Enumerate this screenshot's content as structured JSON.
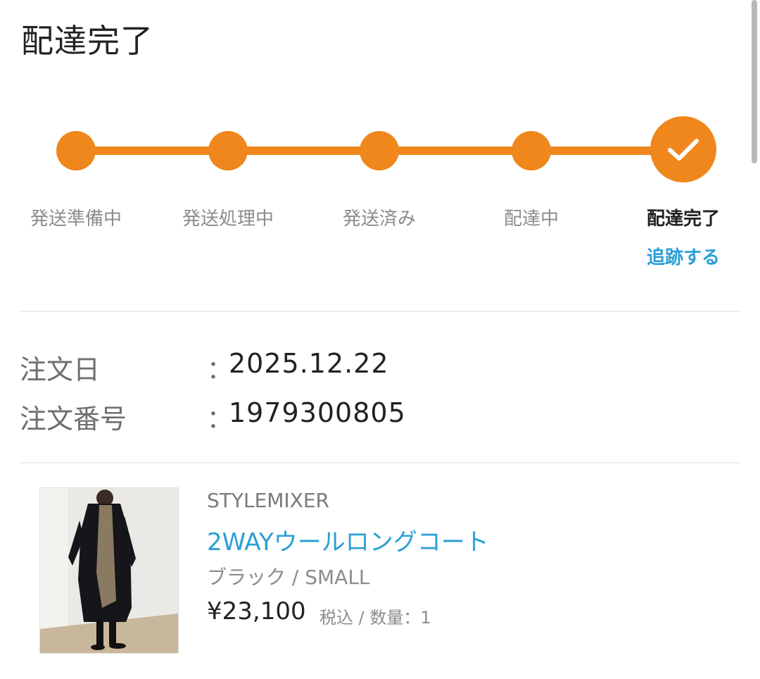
{
  "header": {
    "title": "配達完了"
  },
  "progress": {
    "accent_color": "#f0871c",
    "steps": [
      {
        "label": "発送準備中",
        "state": "done"
      },
      {
        "label": "発送処理中",
        "state": "done"
      },
      {
        "label": "発送済み",
        "state": "done"
      },
      {
        "label": "配達中",
        "state": "done"
      },
      {
        "label": "配達完了",
        "state": "current",
        "icon": "check-icon"
      }
    ],
    "track_link": "追跡する"
  },
  "order": {
    "date_label": "注文日",
    "date_value": "2025.12.22",
    "number_label": "注文番号",
    "number_value": "1979300805",
    "separator": "："
  },
  "item": {
    "brand": "STYLEMIXER",
    "name": "2WAYウールロングコート",
    "variant": "ブラック / SMALL",
    "price": "¥23,100",
    "price_meta": "税込 / 数量：1",
    "link_color": "#2a9fd6"
  }
}
